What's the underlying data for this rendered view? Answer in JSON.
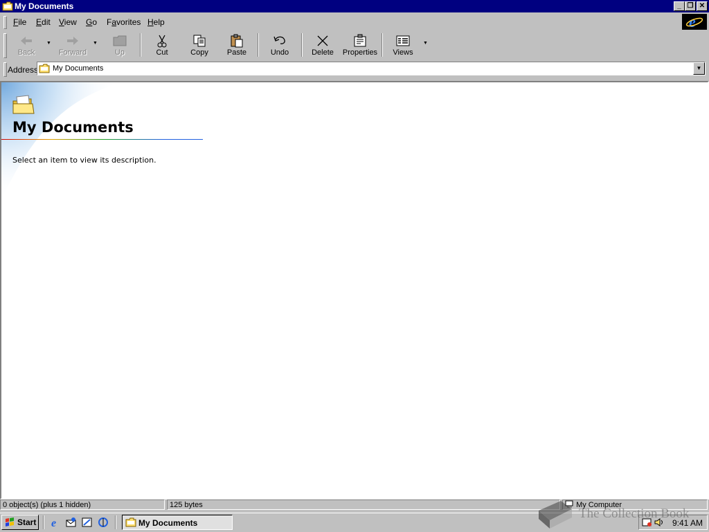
{
  "window": {
    "title": "My Documents",
    "minimize_glyph": "_",
    "restore_glyph": "❐",
    "close_glyph": "✕"
  },
  "menu": {
    "items": [
      {
        "label": "File",
        "accel": "F",
        "rest": "ile"
      },
      {
        "label": "Edit",
        "accel": "E",
        "rest": "dit"
      },
      {
        "label": "View",
        "accel": "V",
        "rest": "iew"
      },
      {
        "label": "Go",
        "accel": "G",
        "rest": "o"
      },
      {
        "label": "Favorites",
        "accel": "a",
        "pre": "F",
        "rest": "vorites"
      },
      {
        "label": "Help",
        "accel": "H",
        "rest": "elp"
      }
    ]
  },
  "toolbar": {
    "back": "Back",
    "forward": "Forward",
    "up": "Up",
    "cut": "Cut",
    "copy": "Copy",
    "paste": "Paste",
    "undo": "Undo",
    "delete": "Delete",
    "properties": "Properties",
    "views": "Views"
  },
  "address": {
    "label": "Address",
    "value": "My Documents"
  },
  "content": {
    "title": "My Documents",
    "description": "Select an item to view its description."
  },
  "status": {
    "objects": "0 object(s) (plus 1 hidden)",
    "size": "125 bytes",
    "zone": "My Computer"
  },
  "taskbar": {
    "start": "Start",
    "task_label": "My Documents",
    "clock": "9:41 AM"
  },
  "watermark": {
    "text": "The Collection Book"
  },
  "colors": {
    "titlebar": "#000080",
    "face": "#c0c0c0",
    "content_bg": "#ffffff"
  }
}
